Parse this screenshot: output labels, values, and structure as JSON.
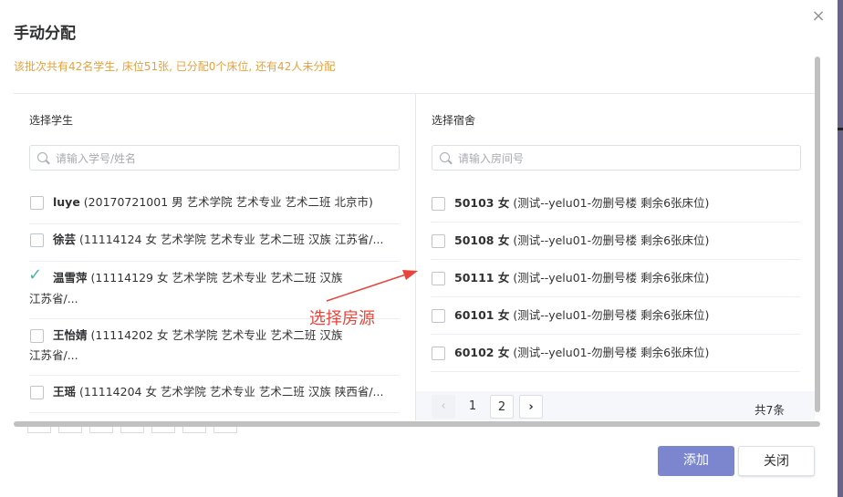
{
  "dialog": {
    "title": "手动分配",
    "close_icon": "×",
    "notice": "该批次共有42名学生, 床位51张, 已分配0个床位, 还有42人未分配"
  },
  "students": {
    "header": "选择学生",
    "search_placeholder": "请输入学号/姓名",
    "items": [
      {
        "name": "luye",
        "line1": " (20170721001 男 艺术学院 艺术专业 艺术二班  北京市)",
        "line2": "",
        "checked": false
      },
      {
        "name": "徐芸",
        "line1": " (11114124 女 艺术学院 艺术专业 艺术二班 汉族 江苏省/...",
        "line2": "",
        "checked": false
      },
      {
        "name": "温雪萍",
        "line1": " (11114129 女 艺术学院 艺术专业 艺术二班 汉族",
        "line2": "江苏省/...",
        "checked": true
      },
      {
        "name": "王怡婧",
        "line1": " (11114202 女 艺术学院 艺术专业 艺术二班 汉族",
        "line2": "江苏省/...",
        "checked": false
      },
      {
        "name": "王瑶",
        "line1": " (11114204 女 艺术学院 艺术专业 艺术二班 汉族 陕西省/...",
        "line2": "",
        "checked": false
      }
    ]
  },
  "dorms": {
    "header": "选择宿舍",
    "search_placeholder": "请输入房间号",
    "items": [
      {
        "room": "50103 女",
        "detail": " (测试--yelu01-勿删号楼 剩余6张床位)"
      },
      {
        "room": "50108 女",
        "detail": " (测试--yelu01-勿删号楼 剩余6张床位)"
      },
      {
        "room": "50111 女",
        "detail": " (测试--yelu01-勿删号楼 剩余6张床位)"
      },
      {
        "room": "60101 女",
        "detail": " (测试--yelu01-勿删号楼 剩余6张床位)"
      },
      {
        "room": "60102 女",
        "detail": " (测试--yelu01-勿删号楼 剩余6张床位)"
      }
    ],
    "pager": {
      "prev": "‹",
      "page1": "1",
      "page2": "2",
      "next": "›",
      "total": "共7条"
    }
  },
  "annotation": {
    "text": "选择房源",
    "color": "#e8453c"
  },
  "footer": {
    "add_label": "添加",
    "close_label": "关闭"
  },
  "colors": {
    "primary": "#7b86cf",
    "warning": "#e6a23c",
    "check": "#52b1a8"
  }
}
